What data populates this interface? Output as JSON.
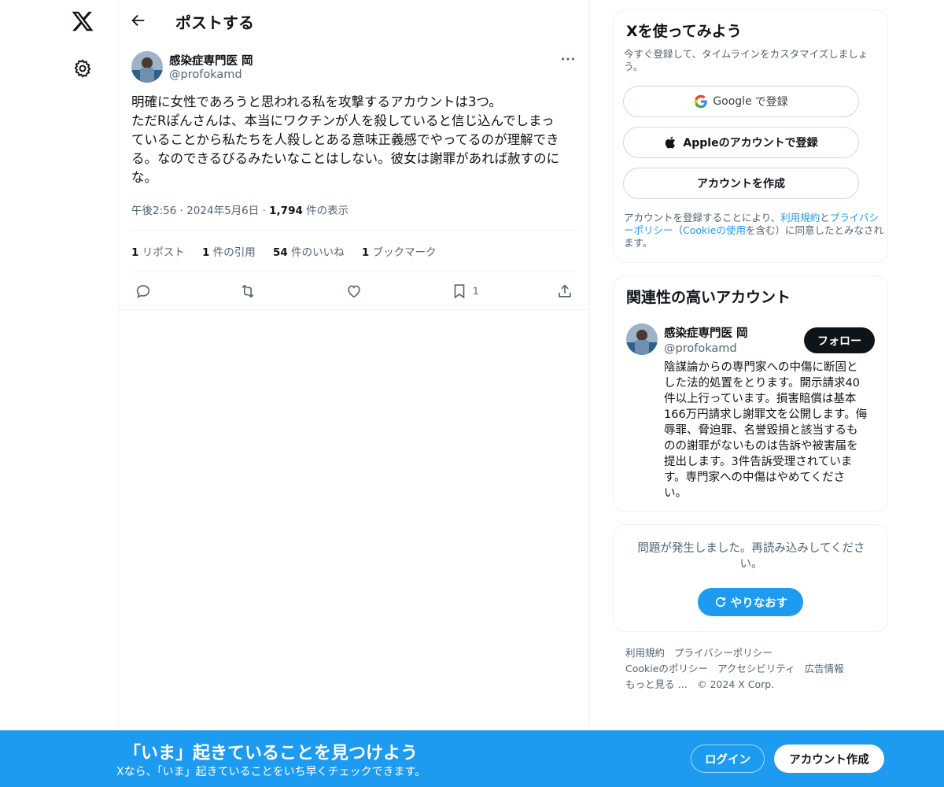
{
  "nav": {
    "logo_icon": "x-logo-icon",
    "settings_icon": "gear-icon"
  },
  "header": {
    "title": "ポストする",
    "back_icon": "arrow-left-icon"
  },
  "tweet": {
    "author_name": "感染症専門医 岡",
    "author_handle": "@profokamd",
    "text_lines": [
      "明確に女性であろうと思われる私を攻撃するアカウントは3つ。",
      "ただRぽんさんは、本当にワクチンが人を殺していると信じ込んでしまっ",
      "ていることから私たちを人殺しとある意味正義感でやってるのが理解でき",
      "る。なのできるびるみたいなことはしない。彼女は謝罪があれば赦すのに",
      "な。"
    ],
    "time": "午後2:56",
    "date": "2024年5月6日",
    "views_count": "1,794",
    "views_label": "件の表示",
    "stats": {
      "reposts_count": "1",
      "reposts_label": "リポスト",
      "quotes_count": "1",
      "quotes_label": "件の引用",
      "likes_count": "54",
      "likes_label": "件のいいね",
      "bookmarks_count": "1",
      "bookmarks_label": "ブックマーク"
    },
    "bookmark_action_count": "1"
  },
  "signup_card": {
    "title": "Xを使ってみよう",
    "subtitle": "今すぐ登録して、タイムラインをカスタマイズしましょう。",
    "google_brand": "Google",
    "google_suffix": "で登録",
    "apple_label": "Appleのアカウントで登録",
    "create_label": "アカウントを作成",
    "terms_prefix": "アカウントを登録することにより、",
    "terms_link": "利用規約",
    "terms_and": "と",
    "privacy_link": "プライバシーポリシー",
    "terms_paren_open": "（",
    "cookie_link": "Cookieの使用",
    "terms_suffix": "を含む）に同意したとみなされます。"
  },
  "related_card": {
    "title": "関連性の高いアカウント",
    "name": "感染症専門医 岡",
    "handle": "@profokamd",
    "follow_label": "フォロー",
    "bio_lines": [
      "陰謀論からの専門家への中傷に断固と",
      "した法的処置をとります。開示請求40",
      "件以上行っています。損害賠償は基本",
      "166万円請求し謝罪文を公開します。侮",
      "辱罪、脅迫罪、名誉毀損と該当するも",
      "のの謝罪がないものは告訴や被害届を",
      "提出します。3件告訴受理されていま",
      "す。専門家への中傷はやめてくださ",
      "い。"
    ]
  },
  "error_card": {
    "message": "問題が発生しました。再読み込みしてください。",
    "retry_label": "やりなおす"
  },
  "footer": {
    "terms": "利用規約",
    "privacy": "プライバシーポリシー",
    "cookies": "Cookieのポリシー",
    "accessibility": "アクセシビリティ",
    "ads": "広告情報",
    "more": "もっと見る …",
    "copyright": "© 2024 X Corp."
  },
  "bottom_bar": {
    "title": "「いま」起きていることを見つけよう",
    "subtitle": "Xなら、「いま」起きていることをいち早くチェックできます。",
    "login_label": "ログイン",
    "signup_label": "アカウント作成"
  },
  "colors": {
    "accent": "#1d9bf0",
    "text": "#0f1419",
    "muted": "#536471",
    "border": "#eff3f4"
  }
}
